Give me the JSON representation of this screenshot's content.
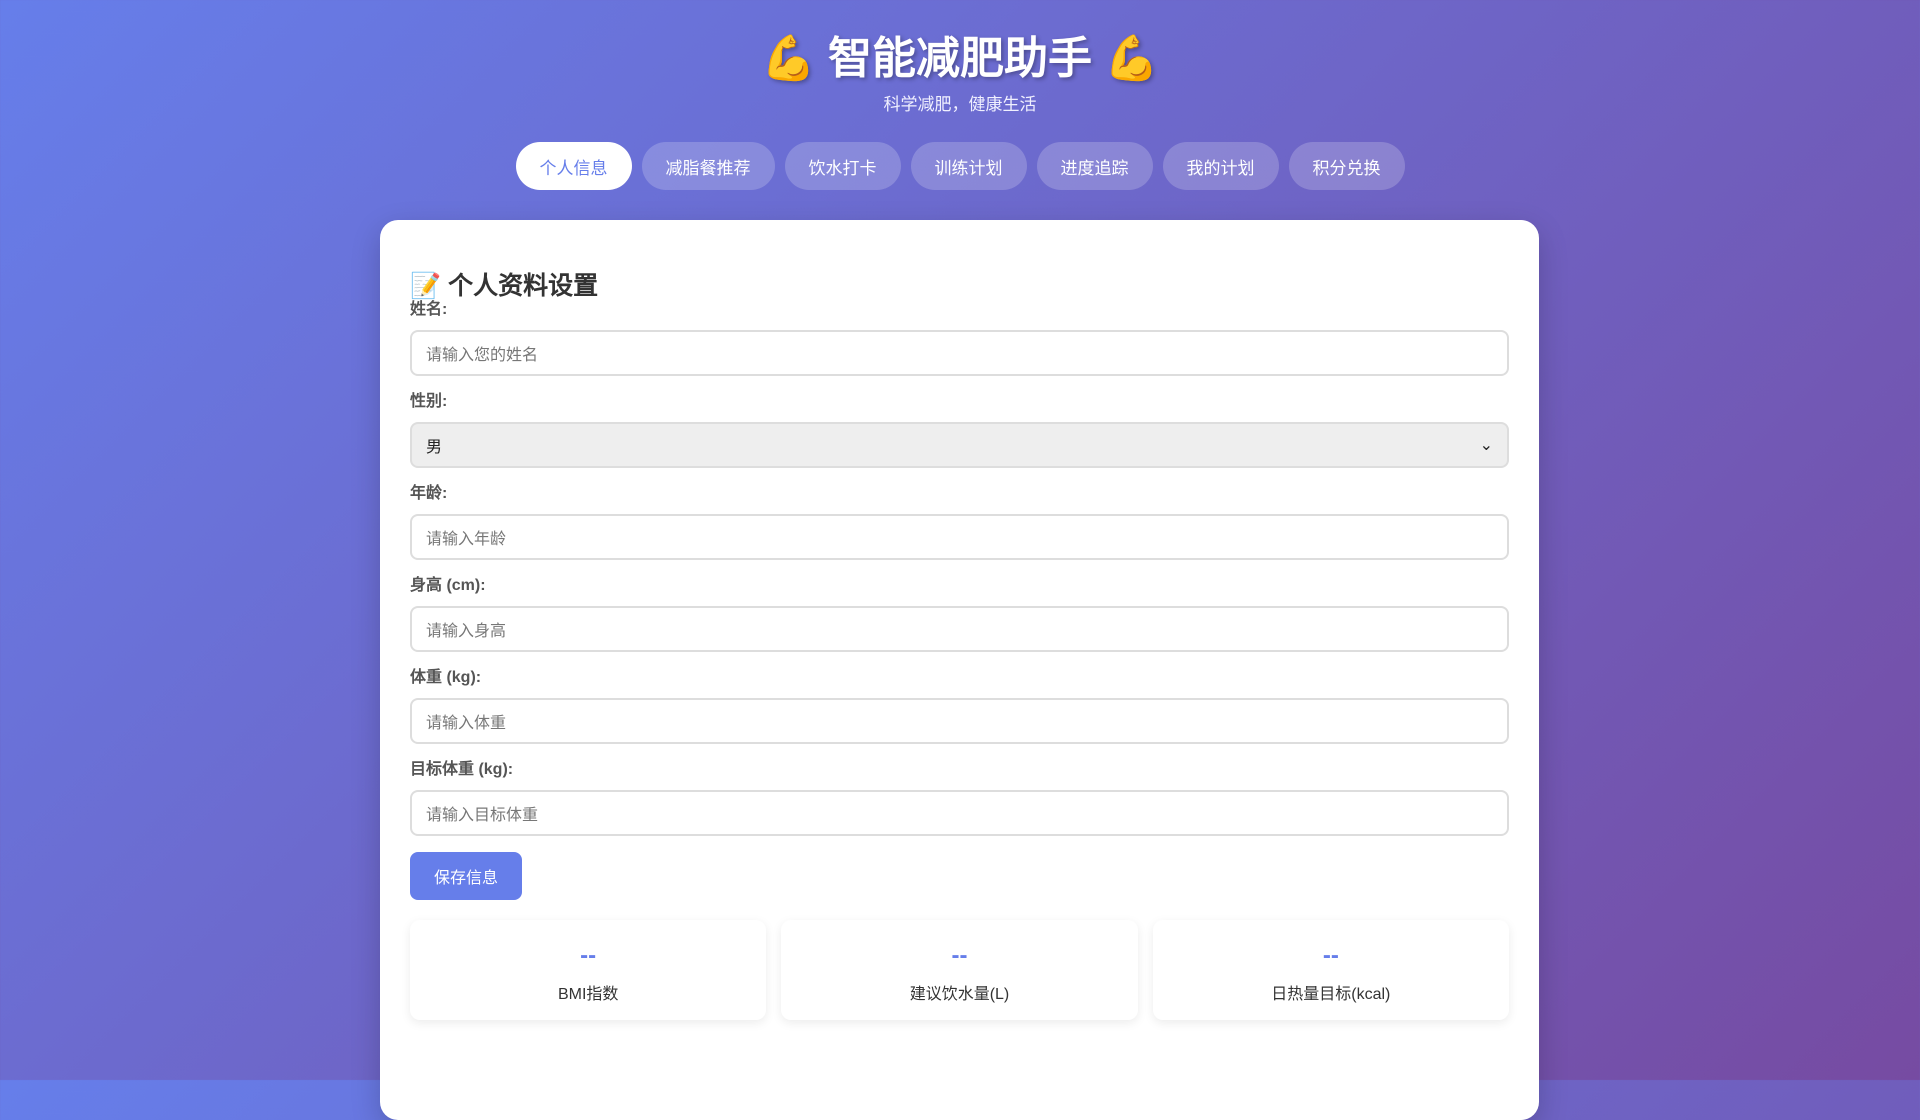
{
  "header": {
    "title": "💪 智能减肥助手 💪",
    "subtitle": "科学减肥，健康生活"
  },
  "tabs": [
    {
      "label": "个人信息",
      "active": true
    },
    {
      "label": "减脂餐推荐"
    },
    {
      "label": "饮水打卡"
    },
    {
      "label": "训练计划"
    },
    {
      "label": "进度追踪"
    },
    {
      "label": "我的计划"
    },
    {
      "label": "积分兑换"
    }
  ],
  "profile": {
    "heading": "📝 个人资料设置",
    "fields": [
      {
        "label": "姓名:",
        "placeholder": "请输入您的姓名"
      },
      {
        "label": "性别:",
        "value": "男"
      },
      {
        "label": "年龄:",
        "placeholder": "请输入年龄"
      },
      {
        "label": "身高 (cm):",
        "placeholder": "请输入身高"
      },
      {
        "label": "体重 (kg):",
        "placeholder": "请输入体重"
      },
      {
        "label": "目标体重 (kg):",
        "placeholder": "请输入目标体重"
      }
    ],
    "save_label": "保存信息",
    "stats": [
      {
        "value": "--",
        "label": "BMI指数"
      },
      {
        "value": "--",
        "label": "建议饮水量(L)"
      },
      {
        "value": "--",
        "label": "日热量目标(kcal)"
      }
    ]
  }
}
